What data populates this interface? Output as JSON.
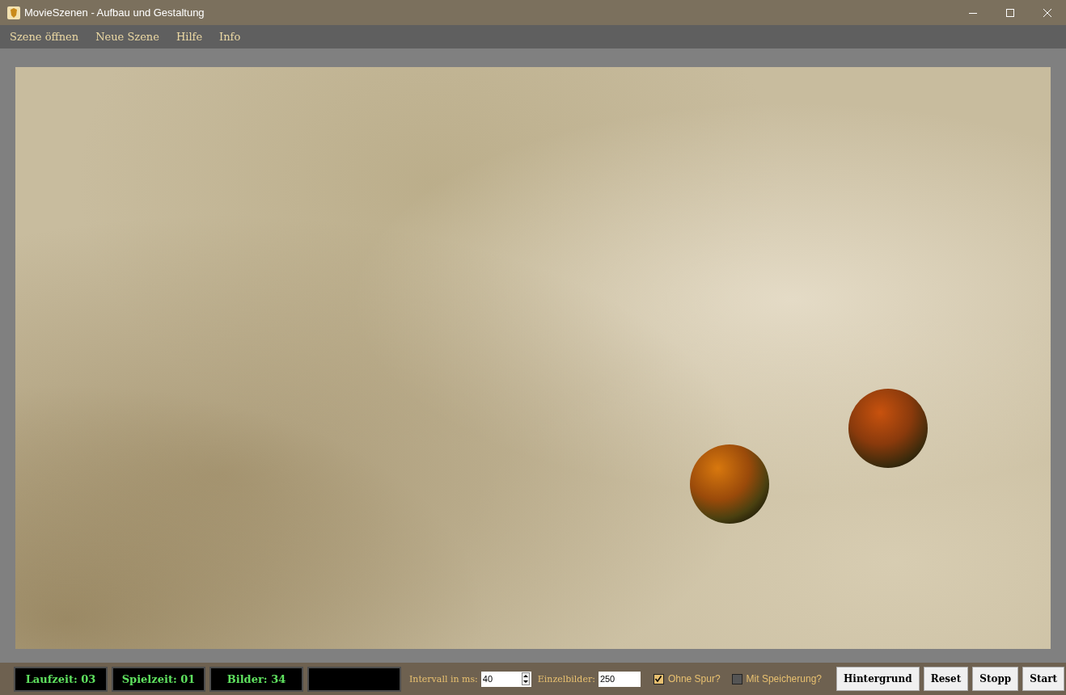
{
  "window": {
    "title": "MovieSzenen - Aufbau und Gestaltung"
  },
  "menu": [
    "Szene öffnen",
    "Neue Szene",
    "Hilfe",
    "Info"
  ],
  "displays": [
    "Laufzeit: 03",
    "Spielzeit: 01",
    "Bilder: 34"
  ],
  "interval": {
    "label": "Intervall in ms:",
    "value": "40"
  },
  "frames": {
    "label": "Einzelbilder:",
    "value": "250"
  },
  "checkboxes": [
    {
      "label": "Ohne Spur?",
      "checked": true
    },
    {
      "label": "Mit Speicherung?",
      "checked": false
    }
  ],
  "buttons": [
    "Hintergrund",
    "Reset",
    "Stopp",
    "Start"
  ]
}
